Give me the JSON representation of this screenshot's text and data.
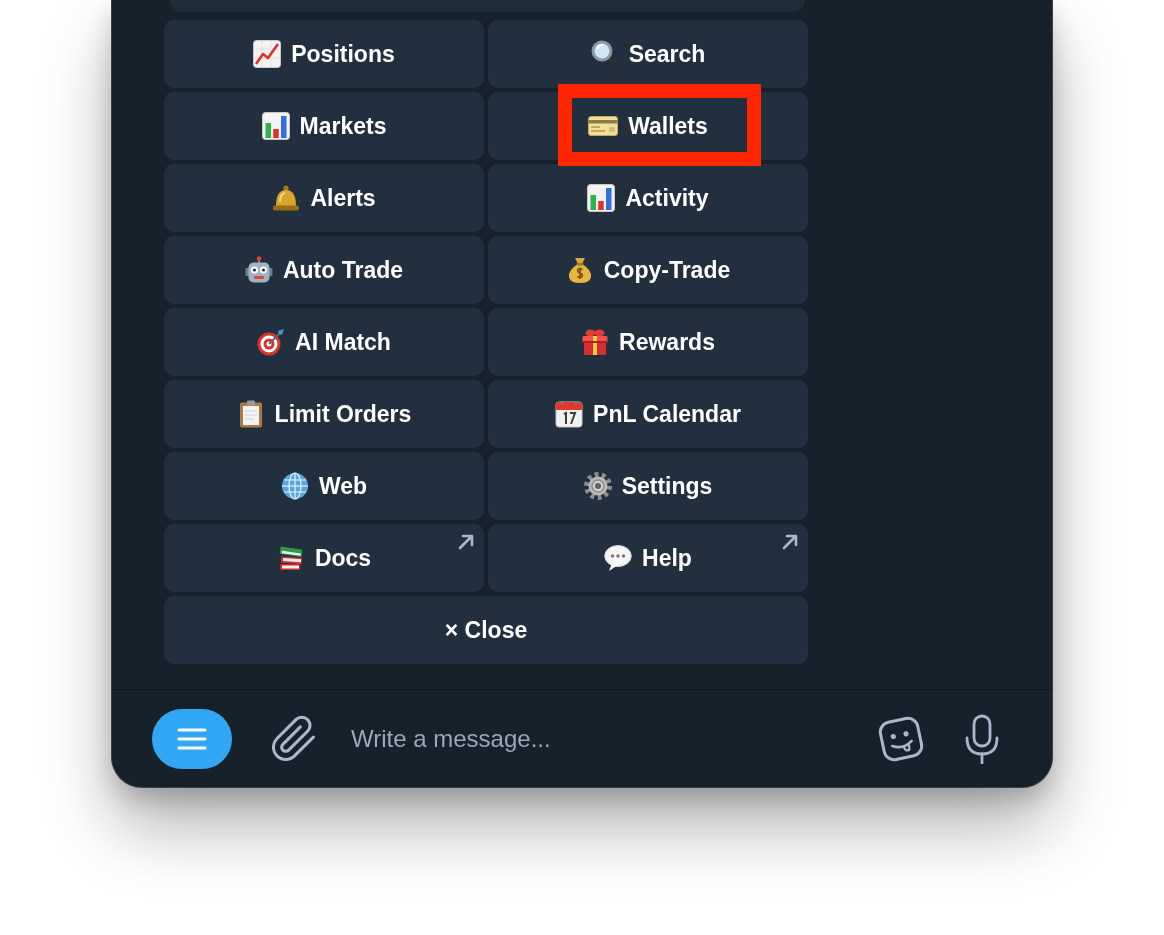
{
  "keyboard": {
    "buttons": [
      {
        "label": "Positions",
        "kind": "action",
        "highlighted": false
      },
      {
        "label": "Search",
        "kind": "action",
        "highlighted": false
      },
      {
        "label": "Markets",
        "kind": "action",
        "highlighted": false
      },
      {
        "label": "Wallets",
        "kind": "action",
        "highlighted": true
      },
      {
        "label": "Alerts",
        "kind": "action",
        "highlighted": false
      },
      {
        "label": "Activity",
        "kind": "action",
        "highlighted": false
      },
      {
        "label": "Auto Trade",
        "kind": "action",
        "highlighted": false
      },
      {
        "label": "Copy-Trade",
        "kind": "action",
        "highlighted": false
      },
      {
        "label": "AI Match",
        "kind": "action",
        "highlighted": false
      },
      {
        "label": "Rewards",
        "kind": "action",
        "highlighted": false
      },
      {
        "label": "Limit Orders",
        "kind": "action",
        "highlighted": false
      },
      {
        "label": "PnL Calendar",
        "kind": "action",
        "highlighted": false
      },
      {
        "label": "Web",
        "kind": "action",
        "highlighted": false
      },
      {
        "label": "Settings",
        "kind": "action",
        "highlighted": false
      },
      {
        "label": "Docs",
        "kind": "link",
        "highlighted": false
      },
      {
        "label": "Help",
        "kind": "link",
        "highlighted": false
      }
    ],
    "close_button": {
      "label": "× Close"
    }
  },
  "composer": {
    "placeholder": "Write a message..."
  }
}
